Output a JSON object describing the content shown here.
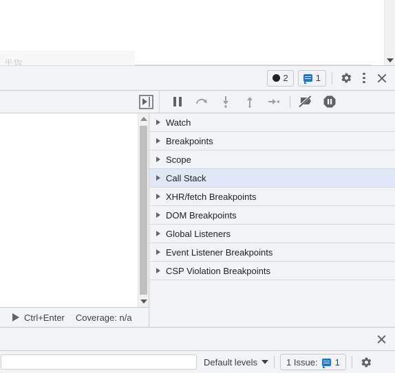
{
  "page": {
    "faded_text": "平仮"
  },
  "devtools_header": {
    "error_badge": {
      "icon": "error-circle-icon",
      "count": "2"
    },
    "message_badge": {
      "icon": "message-icon",
      "count": "1"
    },
    "settings_label": "gear-icon",
    "more_label": "kebab-menu-icon",
    "close_label": "close-icon"
  },
  "debug_toolbar": {
    "show_navigator": "show-navigator-icon",
    "buttons": [
      {
        "name": "pause-script-execution",
        "glyph": "pause"
      },
      {
        "name": "step-over-next-function-call",
        "glyph": "⤻"
      },
      {
        "name": "step-into-next-function-call",
        "glyph": "↓"
      },
      {
        "name": "step-out-of-current-function",
        "glyph": "↑"
      },
      {
        "name": "step",
        "glyph": "→•"
      },
      {
        "name": "deactivate-breakpoints",
        "glyph": "crossed-flag"
      },
      {
        "name": "pause-on-exceptions",
        "glyph": "octagon-pause"
      }
    ]
  },
  "editor": {
    "status": {
      "run_shortcut": "Ctrl+Enter",
      "coverage": "Coverage: n/a"
    }
  },
  "sidebar": {
    "sections": [
      {
        "label": "Watch",
        "selected": false
      },
      {
        "label": "Breakpoints",
        "selected": false
      },
      {
        "label": "Scope",
        "selected": false
      },
      {
        "label": "Call Stack",
        "selected": true
      },
      {
        "label": "XHR/fetch Breakpoints",
        "selected": false
      },
      {
        "label": "DOM Breakpoints",
        "selected": false
      },
      {
        "label": "Global Listeners",
        "selected": false
      },
      {
        "label": "Event Listener Breakpoints",
        "selected": false
      },
      {
        "label": "CSP Violation Breakpoints",
        "selected": false
      }
    ]
  },
  "drawer": {
    "close_label": "close-icon"
  },
  "console_bar": {
    "filter_value": "",
    "filter_placeholder": "",
    "levels_label": "Default levels",
    "issues_label": "1 Issue:",
    "issues_count": "1",
    "settings_label": "gear-icon"
  },
  "colors": {
    "toolbar_bg": "#f1f3f4",
    "selection_blue": "#dfe8f6",
    "accent_blue": "#1a73e8",
    "border": "#cdcdcd",
    "text": "#3c4043"
  }
}
